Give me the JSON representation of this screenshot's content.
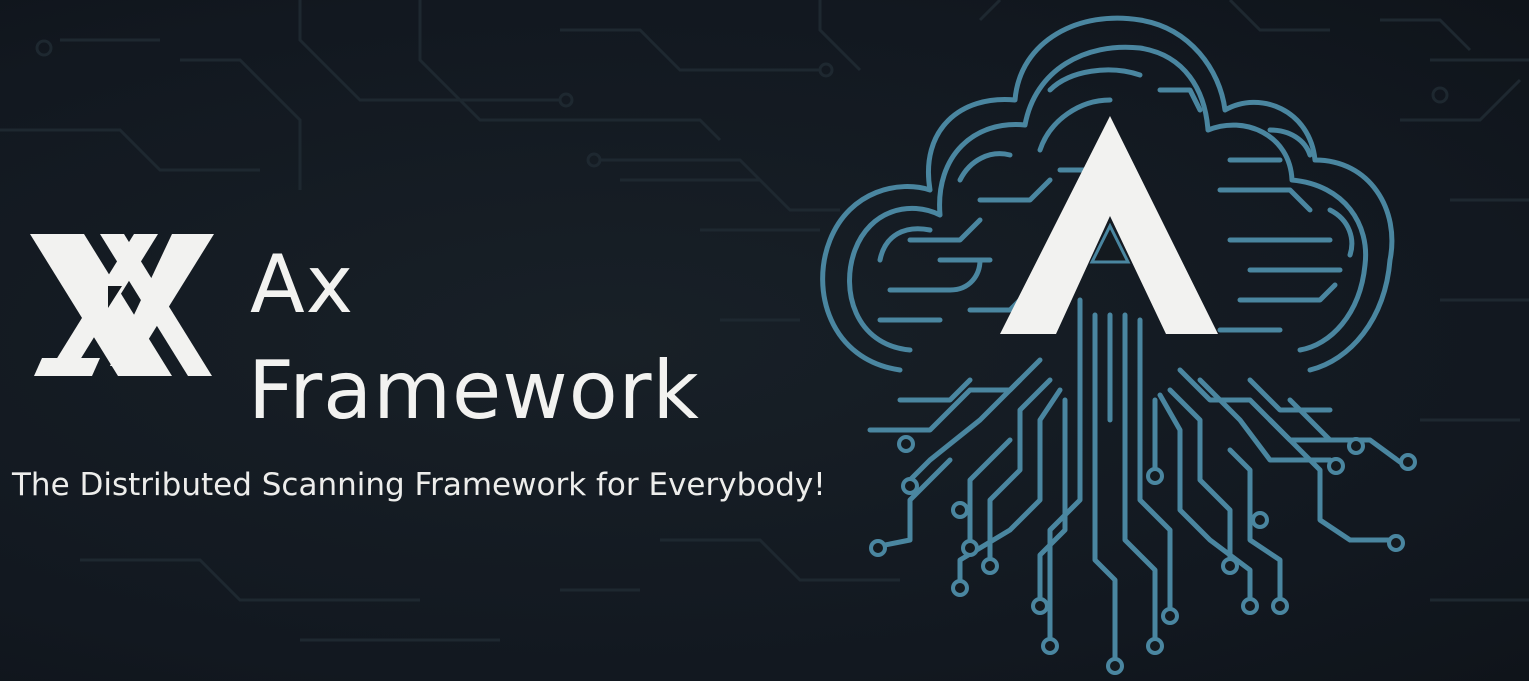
{
  "brand": {
    "title_line1": "Ax",
    "title_line2": "Framework",
    "tagline": "The Distributed Scanning Framework for Everybody!",
    "logo_icon": "ax-logo-icon",
    "hero_icon": "circuit-cloud-icon"
  },
  "colors": {
    "background": "#141a1f",
    "text": "#f2f2f0",
    "accent": "#4a86a0",
    "circuit_bg": "#1f2a33"
  }
}
